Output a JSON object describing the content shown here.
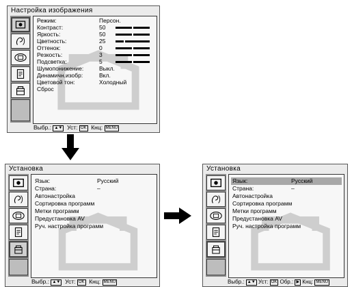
{
  "menu_picture": {
    "title": "Настройка изображения",
    "rows": [
      {
        "label": "Режим:",
        "value": "Персон."
      },
      {
        "label": "Контраст:",
        "value": "50",
        "level": 0.5
      },
      {
        "label": "Яркость:",
        "value": "50",
        "level": 0.5
      },
      {
        "label": "Цветность:",
        "value": "25",
        "level": 0.25
      },
      {
        "label": "Оттенок:",
        "value": "0",
        "level": 0.5
      },
      {
        "label": "Резкость:",
        "value": "3",
        "level": 0.5
      },
      {
        "label": "Подсветка:",
        "value": "5",
        "level": 0.5
      },
      {
        "label": "Шумопонижение:",
        "value": "Выкл."
      },
      {
        "label": "Динамичн.изобр:",
        "value": "Вкл."
      },
      {
        "label": "Цветовой тон:",
        "value": "Холодный"
      },
      {
        "label": "Сброс",
        "value": ""
      }
    ],
    "status": {
      "select": "Выбр.:",
      "set": "Уст:",
      "set_key": "OK",
      "back": "Кнц:",
      "back_key": "MENU"
    }
  },
  "menu_setup_left": {
    "title": "Установка",
    "rows": [
      {
        "label": "Язык:",
        "value": "Русский"
      },
      {
        "label": "Страна:",
        "value": "–"
      },
      {
        "label": "Автонастройка",
        "value": ""
      },
      {
        "label": "Сортировка программ",
        "value": ""
      },
      {
        "label": "Метки программ",
        "value": ""
      },
      {
        "label": "Предустановка AV",
        "value": ""
      },
      {
        "label": "Руч. настройка программ",
        "value": ""
      }
    ],
    "status": {
      "select": "Выбр.:",
      "set": "Уст:",
      "set_key": "OK",
      "back": "Кнц:",
      "back_key": "MENU"
    }
  },
  "menu_setup_right": {
    "title": "Установка",
    "rows": [
      {
        "label": "Язык:",
        "value": "Русский"
      },
      {
        "label": "Страна:",
        "value": "–"
      },
      {
        "label": "Автонастройка",
        "value": ""
      },
      {
        "label": "Сортировка программ",
        "value": ""
      },
      {
        "label": "Метки программ",
        "value": ""
      },
      {
        "label": "Предустановка AV",
        "value": ""
      },
      {
        "label": "Руч. настройка программ",
        "value": ""
      }
    ],
    "status": {
      "select": "Выбр.:",
      "set": "Уст:",
      "set_key": "OK",
      "open": "Обр.:",
      "back": "Кнц:",
      "back_key": "MENU"
    }
  },
  "icons": [
    "picture-icon",
    "sound-icon",
    "screen-icon",
    "features-icon",
    "setup-icon"
  ],
  "colors": {
    "panel_bg": "#ebebeb",
    "icon_column": "#8e8e8e",
    "highlight": "#a8a8a8"
  }
}
